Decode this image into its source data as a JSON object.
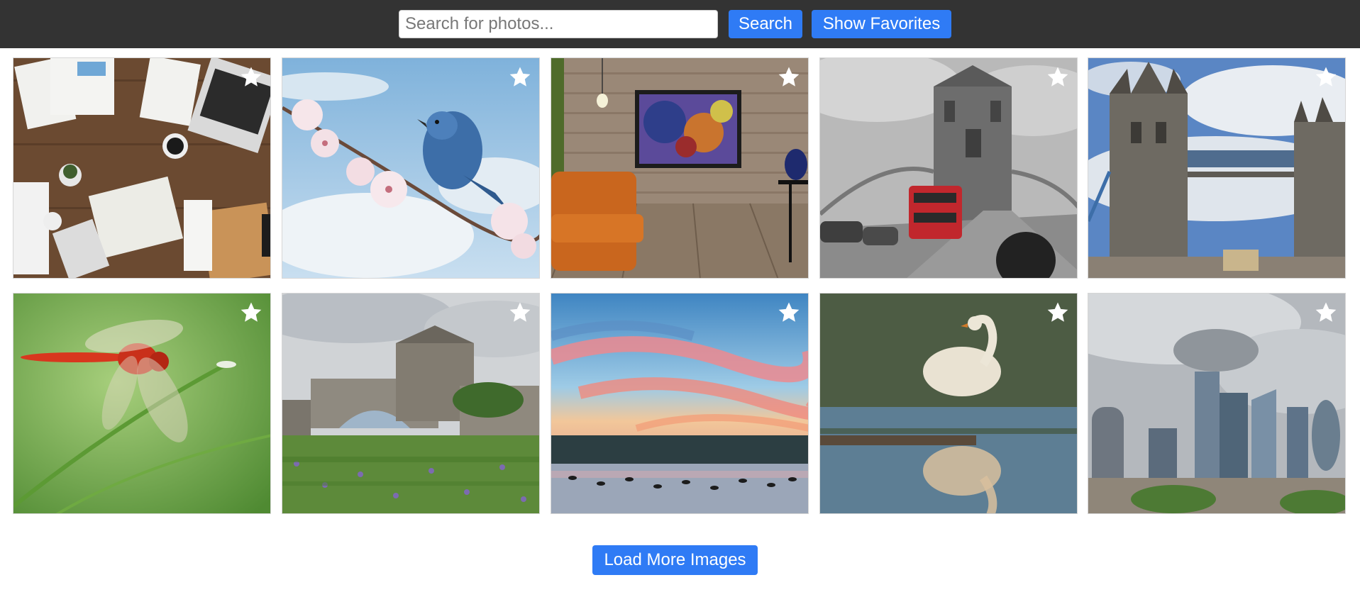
{
  "header": {
    "search": {
      "placeholder": "Search for photos...",
      "value": ""
    },
    "search_button_label": "Search",
    "favorites_button_label": "Show Favorites"
  },
  "gallery": {
    "items": [
      {
        "subject": "office desk with documents",
        "favorite": false
      },
      {
        "subject": "blue bird on blossom branch",
        "favorite": false
      },
      {
        "subject": "armchair and painting on brick wall",
        "favorite": false
      },
      {
        "subject": "tower bridge black and white with red bus",
        "favorite": false
      },
      {
        "subject": "tower bridge",
        "favorite": false
      },
      {
        "subject": "red dragonfly",
        "favorite": false
      },
      {
        "subject": "tower of london with flowers",
        "favorite": false
      },
      {
        "subject": "sunset over lake with birds",
        "favorite": false
      },
      {
        "subject": "swan reflection",
        "favorite": false
      },
      {
        "subject": "london city skyline",
        "favorite": false
      }
    ]
  },
  "footer": {
    "load_more_label": "Load More Images"
  },
  "colors": {
    "topbar": "#333333",
    "accent": "#2f7bf5"
  }
}
